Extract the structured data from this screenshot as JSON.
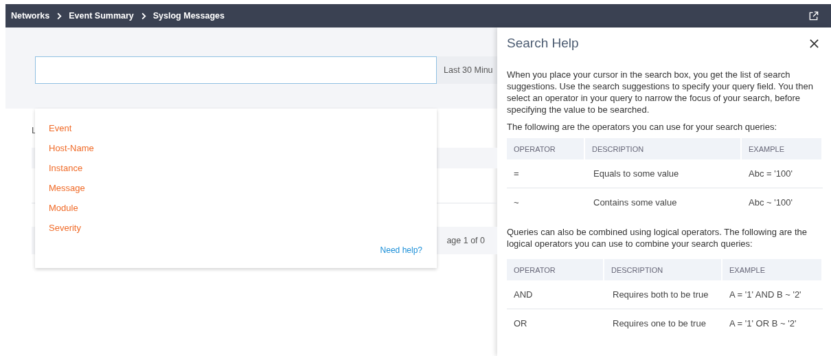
{
  "breadcrumb": [
    {
      "label": "Networks"
    },
    {
      "label": "Event Summary"
    },
    {
      "label": "Syslog Messages"
    }
  ],
  "search": {
    "time_range": "Last 30 Minu"
  },
  "background": {
    "label": "L",
    "pagination": "age 1 of 0"
  },
  "suggestions": [
    "Event",
    "Host-Name",
    "Instance",
    "Message",
    "Module",
    "Severity"
  ],
  "need_help": "Need help?",
  "help": {
    "title": "Search Help",
    "intro": "When you place your cursor in the search box, you get the list of search suggestions. Use the search suggestions to specify your query field. You then select an operator in your query to narrow the focus of your search, before specifying the value to be searched.",
    "tables": [
      {
        "intro": "The following are the operators you can use for your search queries:",
        "columns": [
          "OPERATOR",
          "DESCRIPTION",
          "EXAMPLE"
        ],
        "rows": [
          [
            "=",
            "Equals to some value",
            "Abc = '100'"
          ],
          [
            "~",
            "Contains some value",
            "Abc ~ '100'"
          ]
        ]
      },
      {
        "intro": "Queries can also be combined using logical operators. The following are the logical operators you can use to combine your search queries:",
        "columns": [
          "OPERATOR",
          "DESCRIPTION",
          "EXAMPLE"
        ],
        "rows": [
          [
            "AND",
            "Requires both to be true",
            "A = '1' AND B ~ '2'"
          ],
          [
            "OR",
            "Requires one to be true",
            "A = '1' OR B ~ '2'"
          ]
        ]
      }
    ]
  }
}
